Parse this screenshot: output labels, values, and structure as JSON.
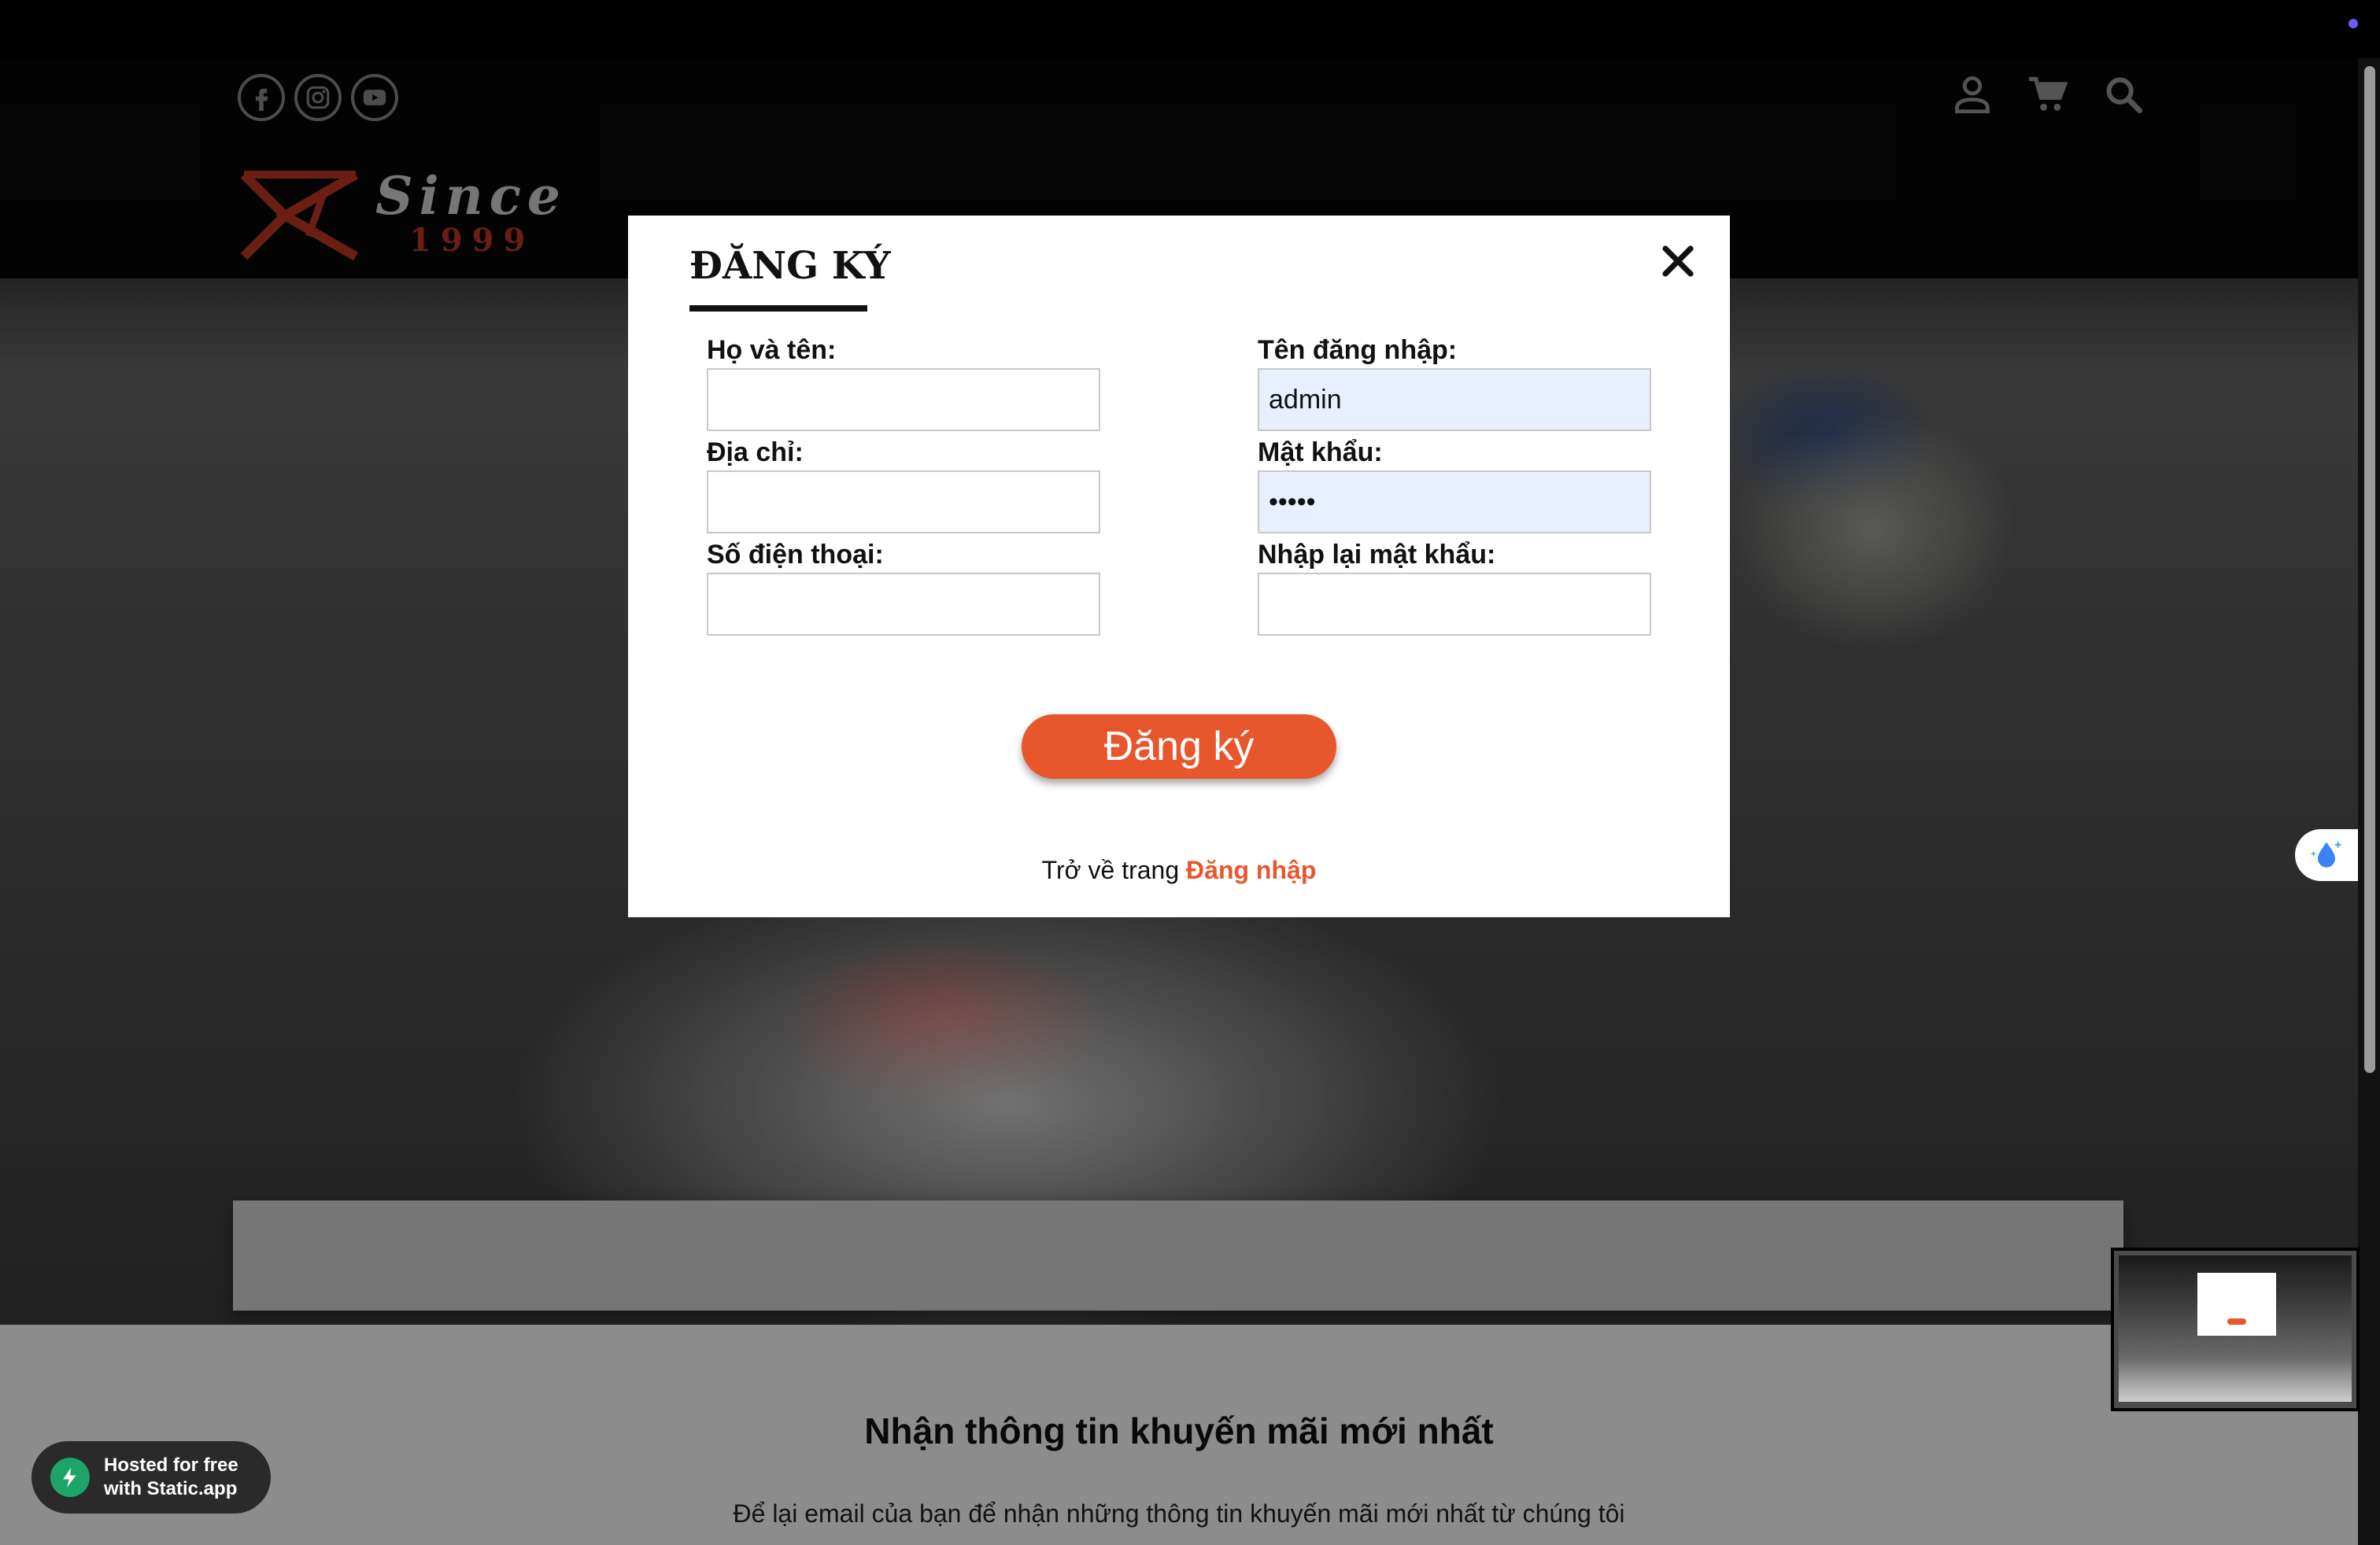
{
  "header": {
    "social_icons": [
      "facebook-icon",
      "instagram-icon",
      "youtube-icon"
    ],
    "action_icons": [
      "user-icon",
      "cart-icon",
      "search-icon"
    ],
    "logo": {
      "since": "Since",
      "year": "1999"
    }
  },
  "modal": {
    "title": "ĐĂNG KÝ",
    "fields": {
      "fullname": {
        "label": "Họ và tên:",
        "value": ""
      },
      "address": {
        "label": "Địa chỉ:",
        "value": ""
      },
      "phone": {
        "label": "Số điện thoại:",
        "value": ""
      },
      "username": {
        "label": "Tên đăng nhập:",
        "value": "admin"
      },
      "password": {
        "label": "Mật khẩu:",
        "value": "•••••"
      },
      "confirm_password": {
        "label": "Nhập lại mật khẩu:",
        "value": ""
      }
    },
    "submit_label": "Đăng ký",
    "back_text": "Trở về trang",
    "back_link": "Đăng nhập"
  },
  "newsletter": {
    "title": "Nhận thông tin khuyến mãi mới nhất",
    "text": "Để lại email của bạn để nhận những thông tin khuyến mãi mới nhất từ chúng tôi"
  },
  "hosted_badge": {
    "line1": "Hosted for free",
    "line2": "with Static.app"
  },
  "colors": {
    "accent": "#e8572c",
    "autofill": "#e8f0fe",
    "badge": "#2a2a2a"
  }
}
